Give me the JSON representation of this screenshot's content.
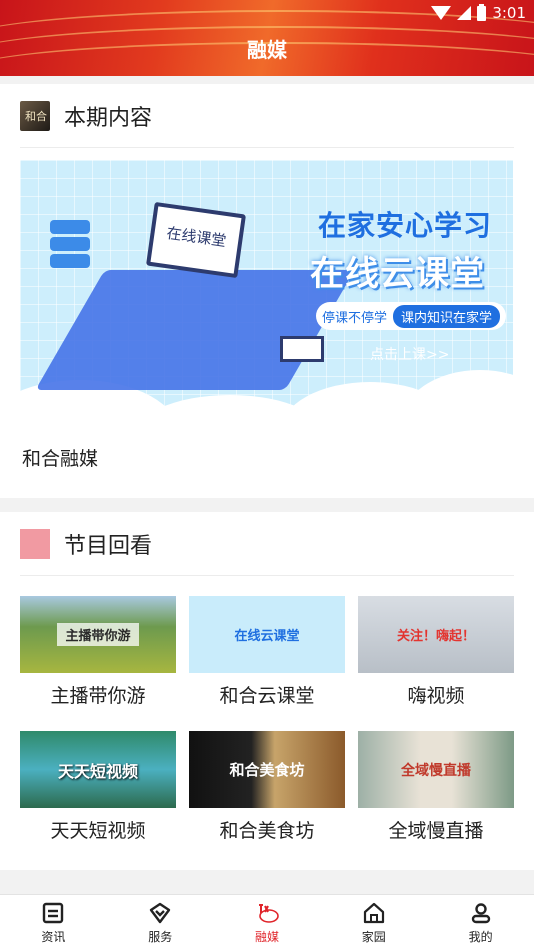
{
  "status_bar": {
    "time": "3:01"
  },
  "header": {
    "title": "融媒"
  },
  "current_issue": {
    "section_title": "本期内容",
    "banner": {
      "headline_1": "在家安心学习",
      "headline_2": "在线云课堂",
      "pill_left": "停课不停学",
      "pill_right": "课内知识在家学",
      "cta": "点击上课>>",
      "board_text": "在线课堂"
    },
    "caption": "和合融媒"
  },
  "replay": {
    "section_title": "节目回看",
    "items": [
      {
        "label": "主播带你游",
        "thumb_text": "主播带你游"
      },
      {
        "label": "和合云课堂",
        "thumb_text": "在线云课堂"
      },
      {
        "label": "嗨视频",
        "thumb_text": "关注！嗨起！"
      },
      {
        "label": "天天短视频",
        "thumb_text": "天天短视频"
      },
      {
        "label": "和合美食坊",
        "thumb_text": "和合美食坊"
      },
      {
        "label": "全域慢直播",
        "thumb_text": "全域慢直播"
      }
    ]
  },
  "tabbar": {
    "items": [
      {
        "label": "资讯",
        "icon": "news-icon"
      },
      {
        "label": "服务",
        "icon": "service-icon"
      },
      {
        "label": "融媒",
        "icon": "media-logo-icon",
        "active": true
      },
      {
        "label": "家园",
        "icon": "home-icon"
      },
      {
        "label": "我的",
        "icon": "profile-icon"
      }
    ]
  },
  "colors": {
    "accent": "#e0252b",
    "header_red": "#c8141a",
    "banner_blue": "#1f6fe0"
  }
}
